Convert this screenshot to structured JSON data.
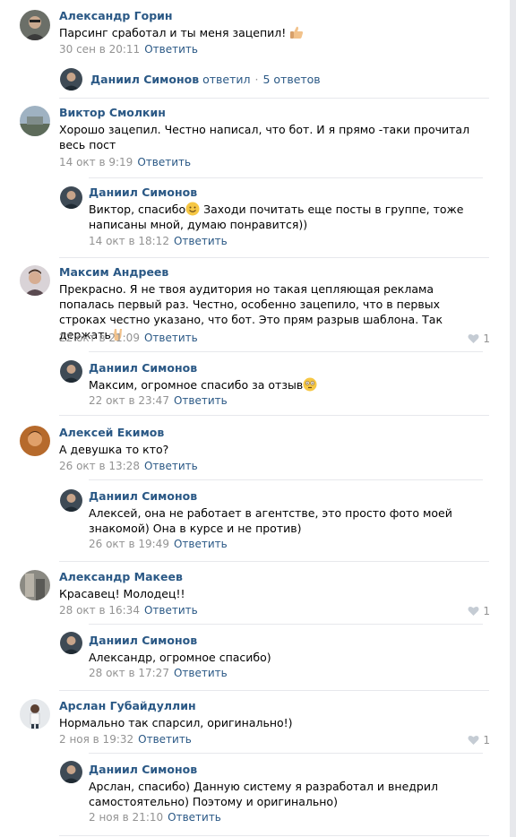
{
  "comments": [
    {
      "author": "Александр Горин",
      "text": "Парсинг сработал и ты меня зацепил!",
      "emoji": "thumbs-up",
      "date": "30 сен в 20:11",
      "reply_label": "Ответить",
      "thread": {
        "author": "Даниил Симонов",
        "action": "ответил",
        "count": "5 ответов"
      }
    },
    {
      "author": "Виктор Смолкин",
      "text": "Хорошо зацепил. Честно написал, что бот. И я прямо -таки прочитал весь пост",
      "date": "14 окт в 9:19",
      "reply_label": "Ответить",
      "reply": {
        "author": "Даниил Симонов",
        "text_a": "Виктор, спасибо",
        "emoji": "smiling-face",
        "text_b": " Заходи почитать еще посты в группе, тоже написаны мной, думаю понравится))",
        "date": "14 окт в 18:12",
        "reply_label": "Ответить"
      }
    },
    {
      "author": "Максим Андреев",
      "text": "Прекрасно. Я не твоя аудитория но такая цепляющая реклама попалась первый раз. Честно, особенно зацепило, что в первых строках честно указано, что бот. Это прям разрыв шаблона. Так держать",
      "emoji": "rock-on-hand",
      "date": "22 окт в 21:09",
      "reply_label": "Ответить",
      "likes": "1",
      "reply": {
        "author": "Даниил Симонов",
        "text_a": "Максим, огромное спасибо за отзыв",
        "emoji": "flushed-face",
        "date": "22 окт в 23:47",
        "reply_label": "Ответить"
      }
    },
    {
      "author": "Алексей Екимов",
      "text": "А девушка то кто?",
      "date": "26 окт в 13:28",
      "reply_label": "Ответить",
      "reply": {
        "author": "Даниил Симонов",
        "text_a": "Алексей, она не работает в агентстве, это просто фото моей знакомой) Она в курсе и не против)",
        "date": "26 окт в 19:49",
        "reply_label": "Ответить"
      }
    },
    {
      "author": "Александр Макеев",
      "text": "Красавец! Молодец!!",
      "date": "28 окт в 16:34",
      "reply_label": "Ответить",
      "likes": "1",
      "reply": {
        "author": "Даниил Симонов",
        "text_a": "Александр, огромное спасибо)",
        "date": "28 окт в 17:27",
        "reply_label": "Ответить"
      }
    },
    {
      "author": "Арслан Губайдуллин",
      "text": "Нормально так спарсил, оригинально!)",
      "date": "2 ноя в 19:32",
      "reply_label": "Ответить",
      "likes": "1",
      "reply": {
        "author": "Даниил Симонов",
        "text_a": "Арслан, спасибо) Данную систему я разработал и внедрил самостоятельно) Поэтому и оригинально)",
        "date": "2 ноя в 21:10",
        "reply_label": "Ответить"
      }
    }
  ],
  "colors": {
    "link": "#2a5885",
    "meta": "#939393",
    "separator": "#e7e8ec"
  }
}
